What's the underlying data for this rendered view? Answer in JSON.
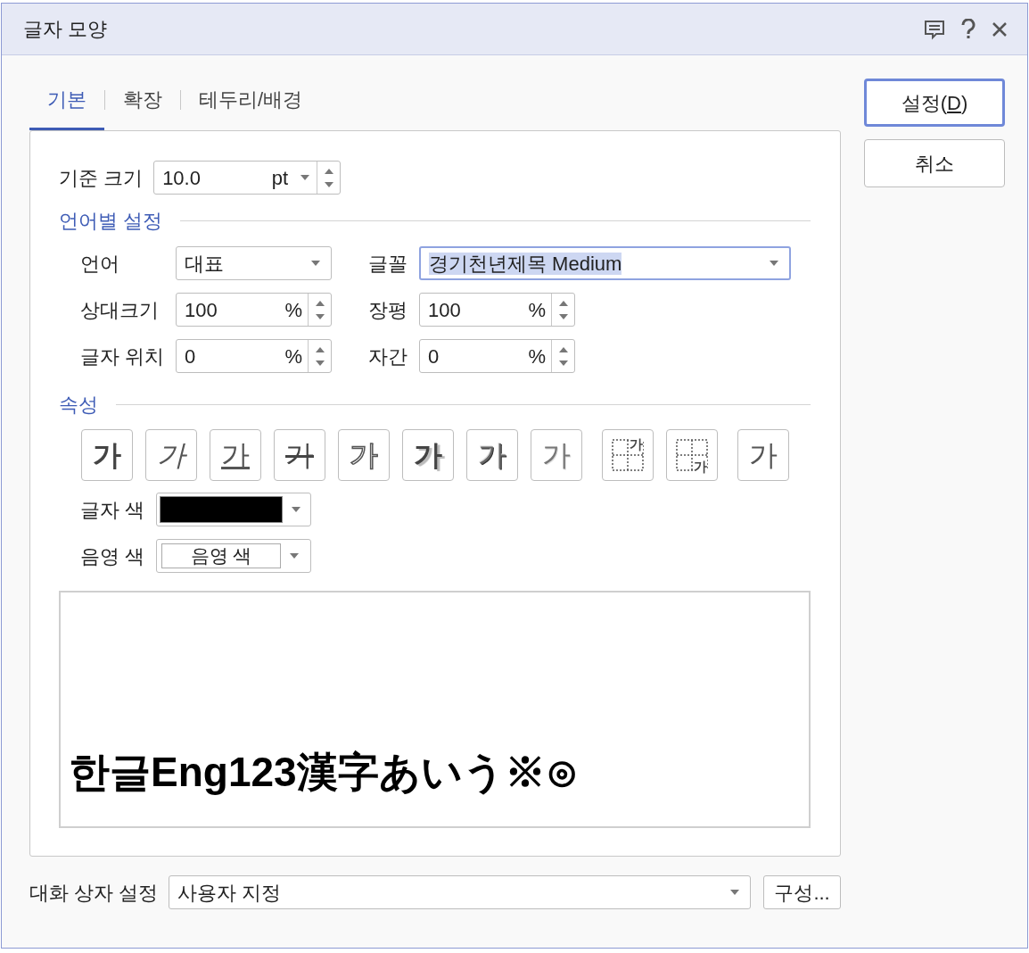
{
  "window": {
    "title": "글자 모양"
  },
  "title_buttons": [
    {
      "kind": "comment"
    },
    {
      "kind": "help"
    },
    {
      "kind": "close"
    }
  ],
  "tabs": [
    {
      "label": "기본",
      "selected": true
    },
    {
      "label": "확장",
      "selected": false
    },
    {
      "label": "테두리/배경",
      "selected": false
    }
  ],
  "base_size": {
    "label": "기준 크기",
    "value": "10.0",
    "unit": "pt"
  },
  "language_section": {
    "title": "언어별 설정",
    "language": {
      "label": "언어",
      "value": "대표"
    },
    "font": {
      "label": "글꼴",
      "value": "경기천년제목 Medium",
      "text_selected": true
    },
    "spinners": [
      {
        "label": "상대크기",
        "value": "100",
        "unit": "%"
      },
      {
        "label": "장평",
        "value": "100",
        "unit": "%"
      },
      {
        "label": "글자 위치",
        "value": "0",
        "unit": "%"
      },
      {
        "label": "자간",
        "value": "0",
        "unit": "%"
      }
    ]
  },
  "attributes_section": {
    "title": "속성",
    "buttons": [
      {
        "kind": "bold",
        "glyph": "가"
      },
      {
        "kind": "italic",
        "glyph": "가"
      },
      {
        "kind": "underline",
        "glyph": "가"
      },
      {
        "kind": "strikeout",
        "glyph": "가"
      },
      {
        "kind": "outline",
        "glyph": "가"
      },
      {
        "kind": "shadow",
        "glyph": "가"
      },
      {
        "kind": "emboss",
        "glyph": "가"
      },
      {
        "kind": "engrave",
        "glyph": "가"
      },
      {
        "kind": "superscript",
        "glyph": "가"
      },
      {
        "kind": "subscript",
        "glyph": "가"
      },
      {
        "kind": "normal",
        "glyph": "가"
      }
    ],
    "text_color": {
      "label": "글자 색",
      "color": "#000000"
    },
    "shade_color": {
      "label": "음영 색",
      "swatch_text": "음영 색"
    }
  },
  "preview": {
    "text": "한글Eng123漢字あいう※⊙"
  },
  "dialog_setting": {
    "label": "대화 상자 설정",
    "value": "사용자 지정"
  },
  "configure_button": "구성...",
  "actions": [
    {
      "label": "설정(",
      "mnemonic": "D",
      "label_end": ")",
      "default": true
    },
    {
      "label": "취소",
      "default": false
    }
  ]
}
